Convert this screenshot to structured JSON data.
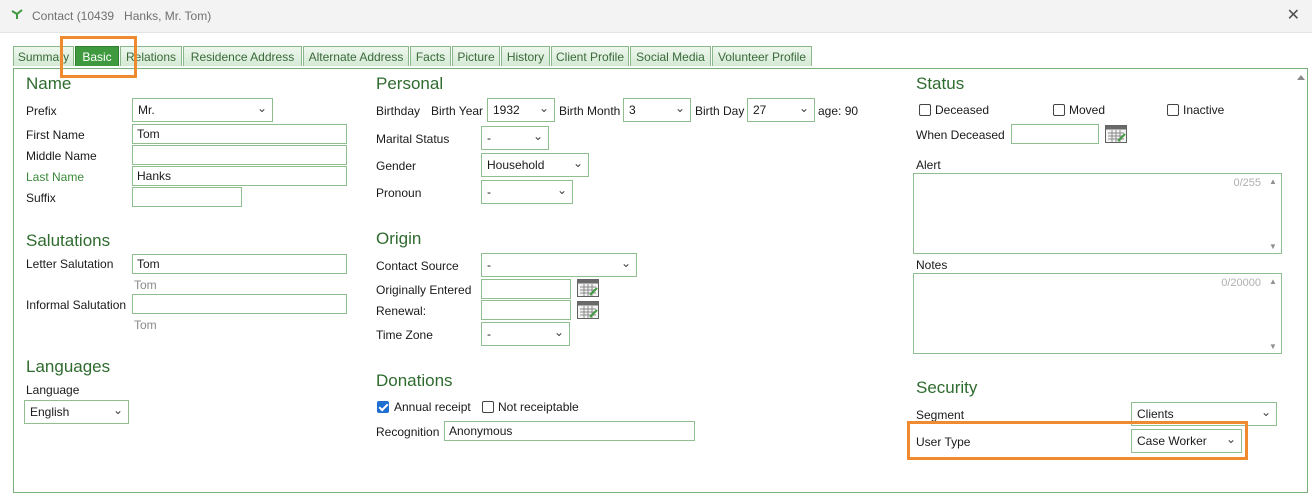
{
  "window": {
    "title": "Contact (10439   Hanks, Mr. Tom)",
    "close_glyph": "✕"
  },
  "tabs": [
    "Summary",
    "Basic",
    "Relations",
    "Residence Address",
    "Alternate Address",
    "Facts",
    "Picture",
    "History",
    "Client Profile",
    "Social Media",
    "Volunteer Profile"
  ],
  "active_tab": "Basic",
  "name": {
    "header": "Name",
    "prefix_label": "Prefix",
    "prefix_value": "Mr.",
    "first_label": "First Name",
    "first_value": "Tom",
    "middle_label": "Middle Name",
    "middle_value": "",
    "last_label": "Last Name",
    "last_value": "Hanks",
    "suffix_label": "Suffix",
    "suffix_value": ""
  },
  "salutations": {
    "header": "Salutations",
    "letter_label": "Letter Salutation",
    "letter_value": "Tom",
    "letter_hint": "Tom",
    "informal_label": "Informal Salutation",
    "informal_value": "",
    "informal_hint": "Tom"
  },
  "languages": {
    "header": "Languages",
    "language_label": "Language",
    "language_value": "English"
  },
  "personal": {
    "header": "Personal",
    "birthday_label": "Birthday",
    "birth_year_label": "Birth Year",
    "birth_year_value": "1932",
    "birth_month_label": "Birth Month",
    "birth_month_value": "3",
    "birth_day_label": "Birth Day",
    "birth_day_value": "27",
    "age_text": "age: 90",
    "marital_label": "Marital Status",
    "marital_value": "-",
    "gender_label": "Gender",
    "gender_value": "Household",
    "pronoun_label": "Pronoun",
    "pronoun_value": "-"
  },
  "origin": {
    "header": "Origin",
    "source_label": "Contact Source",
    "source_value": "-",
    "entered_label": "Originally Entered",
    "entered_value": "",
    "renewal_label": "Renewal:",
    "renewal_value": "",
    "timezone_label": "Time Zone",
    "timezone_value": "-"
  },
  "donations": {
    "header": "Donations",
    "annual_label": "Annual receipt",
    "annual_checked": true,
    "not_receiptable_label": "Not receiptable",
    "not_receiptable_checked": false,
    "recognition_label": "Recognition",
    "recognition_value": "Anonymous"
  },
  "status": {
    "header": "Status",
    "deceased_label": "Deceased",
    "moved_label": "Moved",
    "inactive_label": "Inactive",
    "when_deceased_label": "When Deceased",
    "when_deceased_value": "",
    "alert_label": "Alert",
    "alert_counter": "0/255",
    "notes_label": "Notes",
    "notes_counter": "0/20000"
  },
  "security": {
    "header": "Security",
    "segment_label": "Segment",
    "segment_value": "Clients",
    "user_type_label": "User Type",
    "user_type_value": "Case Worker"
  },
  "colors": {
    "accent_green": "#3f9a3f",
    "highlight_orange": "#f08a2e",
    "heading_green": "#2f6b2f"
  },
  "icons": {
    "chevron": "chevron-down-icon",
    "calendar": "calendar-icon",
    "close": "close-icon",
    "app": "app-logo-icon"
  }
}
